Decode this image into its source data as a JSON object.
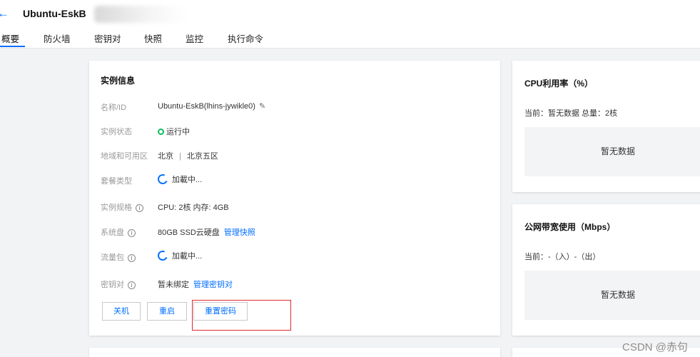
{
  "header": {
    "back_icon": "arrow-left-icon",
    "title": "Ubuntu-EskB",
    "tabs": [
      "概要",
      "防火墙",
      "密钥对",
      "快照",
      "监控",
      "执行命令"
    ]
  },
  "instance": {
    "title": "实例信息",
    "rows": [
      {
        "label": "名称/ID",
        "value": "Ubuntu-EskB(lhins-jywikle0)"
      },
      {
        "label": "实例状态",
        "value": "运行中"
      },
      {
        "label": "地域和可用区",
        "region": "北京",
        "separator": "|",
        "zone": "北京五区"
      },
      {
        "label": "套餐类型",
        "value": "加載中..."
      },
      {
        "label": "实例规格",
        "value": "CPU: 2核 内存: 4GB"
      },
      {
        "label": "系统盘",
        "value": "80GB SSD云硬盘",
        "link": "管理快照"
      },
      {
        "label": "流量包",
        "value": "加載中..."
      },
      {
        "label": "密钥对",
        "value": "暂未绑定",
        "link": "管理密钥对"
      }
    ],
    "buttons": {
      "shutdown": "关机",
      "restart": "重启",
      "reset_password": "重置密码"
    }
  },
  "cpu": {
    "title": "CPU利用率（%）",
    "subtitle": "当前：暂无数据 总量：2核",
    "empty": "暂无数据"
  },
  "bandwidth": {
    "title": "公网带宽使用（Mbps）",
    "subtitle": "当前：-（入）-（出）",
    "empty": "暂无数据"
  },
  "watermark": "CSDN @赤句",
  "colors": {
    "accent": "#006eff",
    "running": "#0abf5b",
    "highlight_box": "#e0292f"
  }
}
